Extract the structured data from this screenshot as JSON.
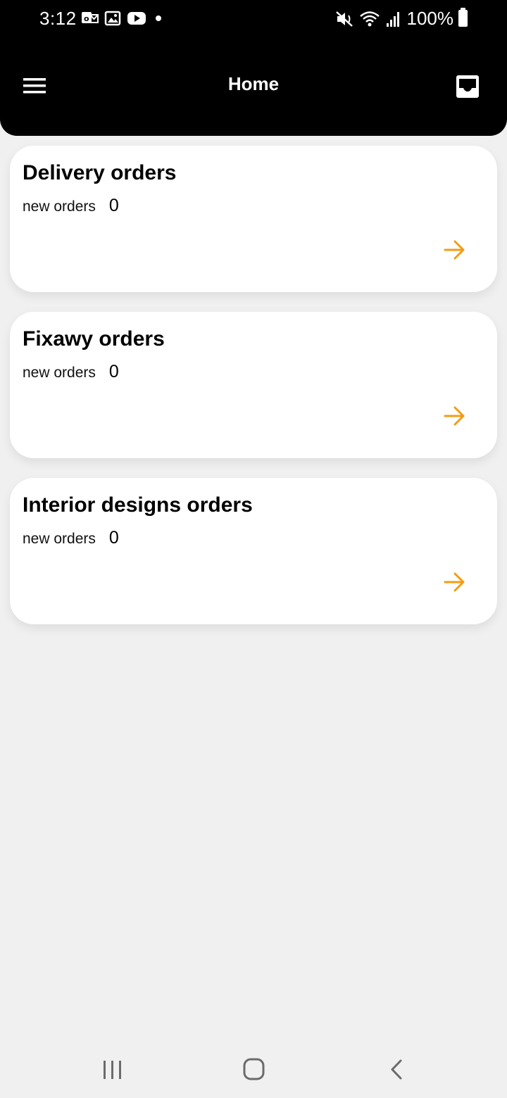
{
  "status_bar": {
    "time": "3:12",
    "battery_text": "100%",
    "icons_left": [
      "mail-notification-icon",
      "gallery-icon",
      "youtube-icon",
      "dot-icon"
    ],
    "icons_right": [
      "mute-vibrate-icon",
      "wifi-icon",
      "signal-icon",
      "battery-icon"
    ]
  },
  "app_bar": {
    "title": "Home",
    "left_icon": "menu-icon",
    "right_icon": "inbox-icon"
  },
  "cards": [
    {
      "title": "Delivery orders",
      "sub_label": "new orders",
      "count": "0"
    },
    {
      "title": "Fixawy orders",
      "sub_label": "new orders",
      "count": "0"
    },
    {
      "title": "Interior designs orders",
      "sub_label": "new orders",
      "count": "0"
    }
  ],
  "colors": {
    "accent_arrow": "#F39C12",
    "header_bg": "#000000",
    "page_bg": "#F0F0F0"
  },
  "nav_bar": {
    "buttons": [
      "recents-icon",
      "home-icon",
      "back-icon"
    ]
  }
}
